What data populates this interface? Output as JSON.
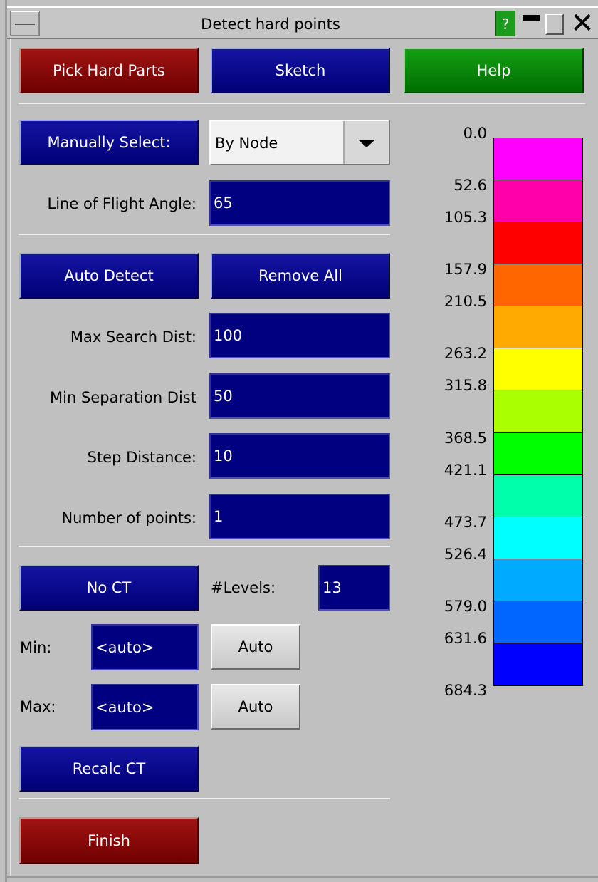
{
  "window": {
    "title": "Detect hard points",
    "help_glyph": "?",
    "close_glyph": "✕"
  },
  "top_buttons": {
    "pick_hard_parts": "Pick Hard Parts",
    "sketch": "Sketch",
    "help": "Help"
  },
  "manual": {
    "button": "Manually Select:",
    "select_value": "By Node",
    "line_of_flight_label": "Line of Flight Angle:",
    "line_of_flight_value": "65"
  },
  "auto": {
    "auto_detect": "Auto Detect",
    "remove_all": "Remove All",
    "max_search_label": "Max Search Dist:",
    "max_search_value": "100",
    "min_sep_label": "Min Separation Dist",
    "min_sep_value": "50",
    "step_label": "Step Distance:",
    "step_value": "10",
    "num_points_label": "Number of points:",
    "num_points_value": "1"
  },
  "contour": {
    "no_ct": "No CT",
    "levels_label": "#Levels:",
    "levels_value": "13",
    "min_label": "Min:",
    "min_value": "<auto>",
    "min_auto": "Auto",
    "max_label": "Max:",
    "max_value": "<auto>",
    "max_auto": "Auto",
    "recalc": "Recalc CT"
  },
  "finish": "Finish",
  "legend": {
    "ticks": [
      "0.0",
      "52.6",
      "105.3",
      "157.9",
      "210.5",
      "263.2",
      "315.8",
      "368.5",
      "421.1",
      "473.7",
      "526.4",
      "579.0",
      "631.6",
      "684.3"
    ],
    "colors": [
      "#ff00ff",
      "#ff00aa",
      "#ff0000",
      "#ff6600",
      "#ffaa00",
      "#ffff00",
      "#aaff00",
      "#00ff00",
      "#00ffaa",
      "#00ffff",
      "#00aaff",
      "#0066ff",
      "#0000ff"
    ]
  }
}
